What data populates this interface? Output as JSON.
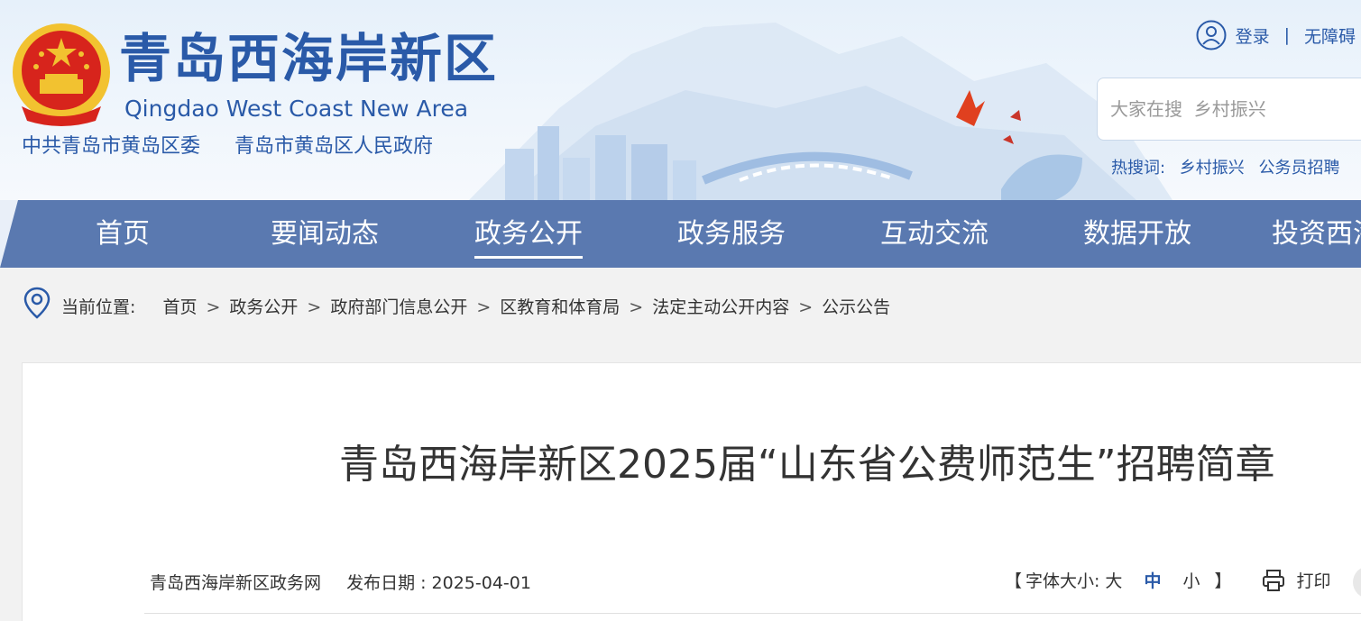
{
  "header": {
    "site_title": "青岛西海岸新区",
    "site_subtitle": "Qingdao West Coast New Area",
    "org_left": "中共青岛市黄岛区委",
    "org_right": "青岛市黄岛区人民政府",
    "login_label": "登录",
    "divider": "|",
    "accessibility_label": "无障碍",
    "search_placeholder": "大家在搜  乡村振兴",
    "hot_search_label": "热搜词:",
    "hot_search_items": [
      "乡村振兴",
      "公务员招聘"
    ]
  },
  "nav": {
    "items": [
      "首页",
      "要闻动态",
      "政务公开",
      "政务服务",
      "互动交流",
      "数据开放",
      "投资西海"
    ],
    "active_index": 2
  },
  "breadcrumb": {
    "label": "当前位置:",
    "sep": ">",
    "items": [
      "首页",
      "政务公开",
      "政府部门信息公开",
      "区教育和体育局",
      "法定主动公开内容",
      "公示公告"
    ]
  },
  "article": {
    "title": "青岛西海岸新区2025届“山东省公费师范生”招聘简章",
    "source": "青岛西海岸新区政务网",
    "publish_date": "发布日期 : 2025-04-01",
    "font_size_open": "【",
    "font_size_label": "字体大小:",
    "size_large": "大",
    "size_medium": "中",
    "size_small": "小",
    "font_size_close": "】",
    "print_label": "打印"
  },
  "colors": {
    "brand_blue": "#2a5aa8",
    "nav_bg": "#5a79b0",
    "emblem_red": "#d7241c",
    "emblem_gold": "#f2c230"
  }
}
